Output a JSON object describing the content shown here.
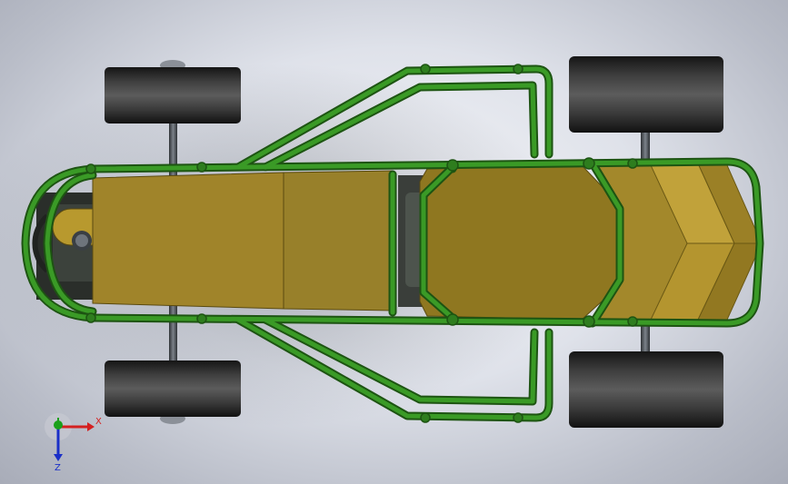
{
  "viewport": {
    "background_colors": [
      "#f4f5f8",
      "#dfe2ea",
      "#b9bdc8"
    ]
  },
  "model": {
    "colors": {
      "frame_tube": "#2e7d1e",
      "frame_tube_dark": "#1d5412",
      "panel": "#a68a2a",
      "panel_light": "#c2a23a",
      "panel_dark": "#7a6418",
      "tire": "#2a2a2a",
      "tire_highlight": "#5a5a5a",
      "axle": "#4a4f55"
    }
  },
  "triad": {
    "x_label": "X",
    "z_label": "Z",
    "y_label": "Y",
    "x_color": "#d42020",
    "z_color": "#1a2fc8",
    "y_color": "#1aa01a"
  }
}
